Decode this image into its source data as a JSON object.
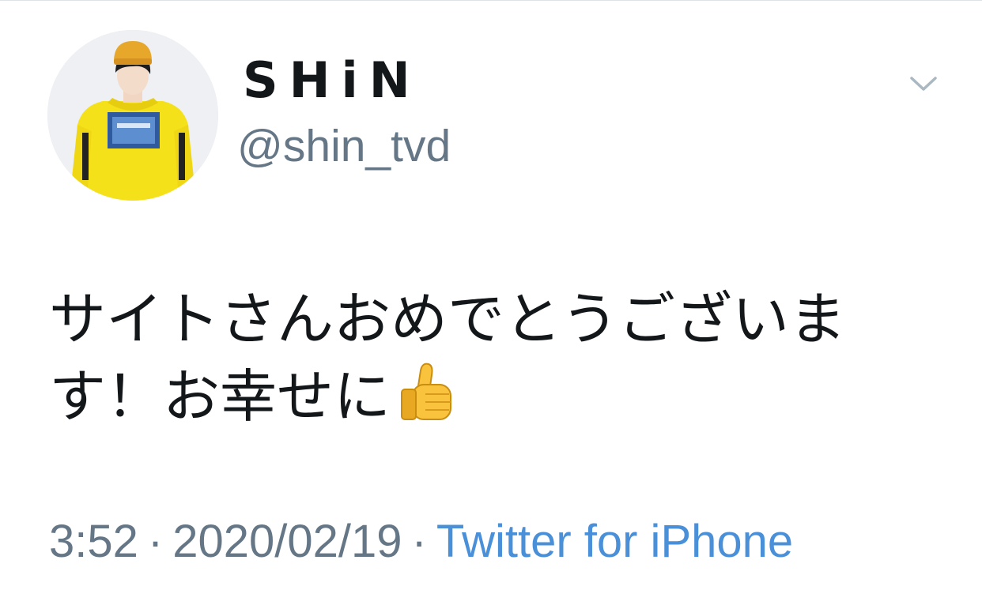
{
  "user": {
    "display_name": "SHiN",
    "handle": "@shin_tvd",
    "avatar_icon": "profile-photo"
  },
  "tweet": {
    "text": "サイトさんおめでとうございます！お幸せに",
    "emoji": "thumbs-up-emoji"
  },
  "meta": {
    "time": "3:52",
    "separator": "·",
    "date": "2020/02/19",
    "source": "Twitter for iPhone"
  },
  "menu_icon": "chevron-down-icon",
  "colors": {
    "text": "#14171a",
    "secondary": "#657786",
    "link": "#4a90d9",
    "hoodie": "#f5e11a"
  }
}
